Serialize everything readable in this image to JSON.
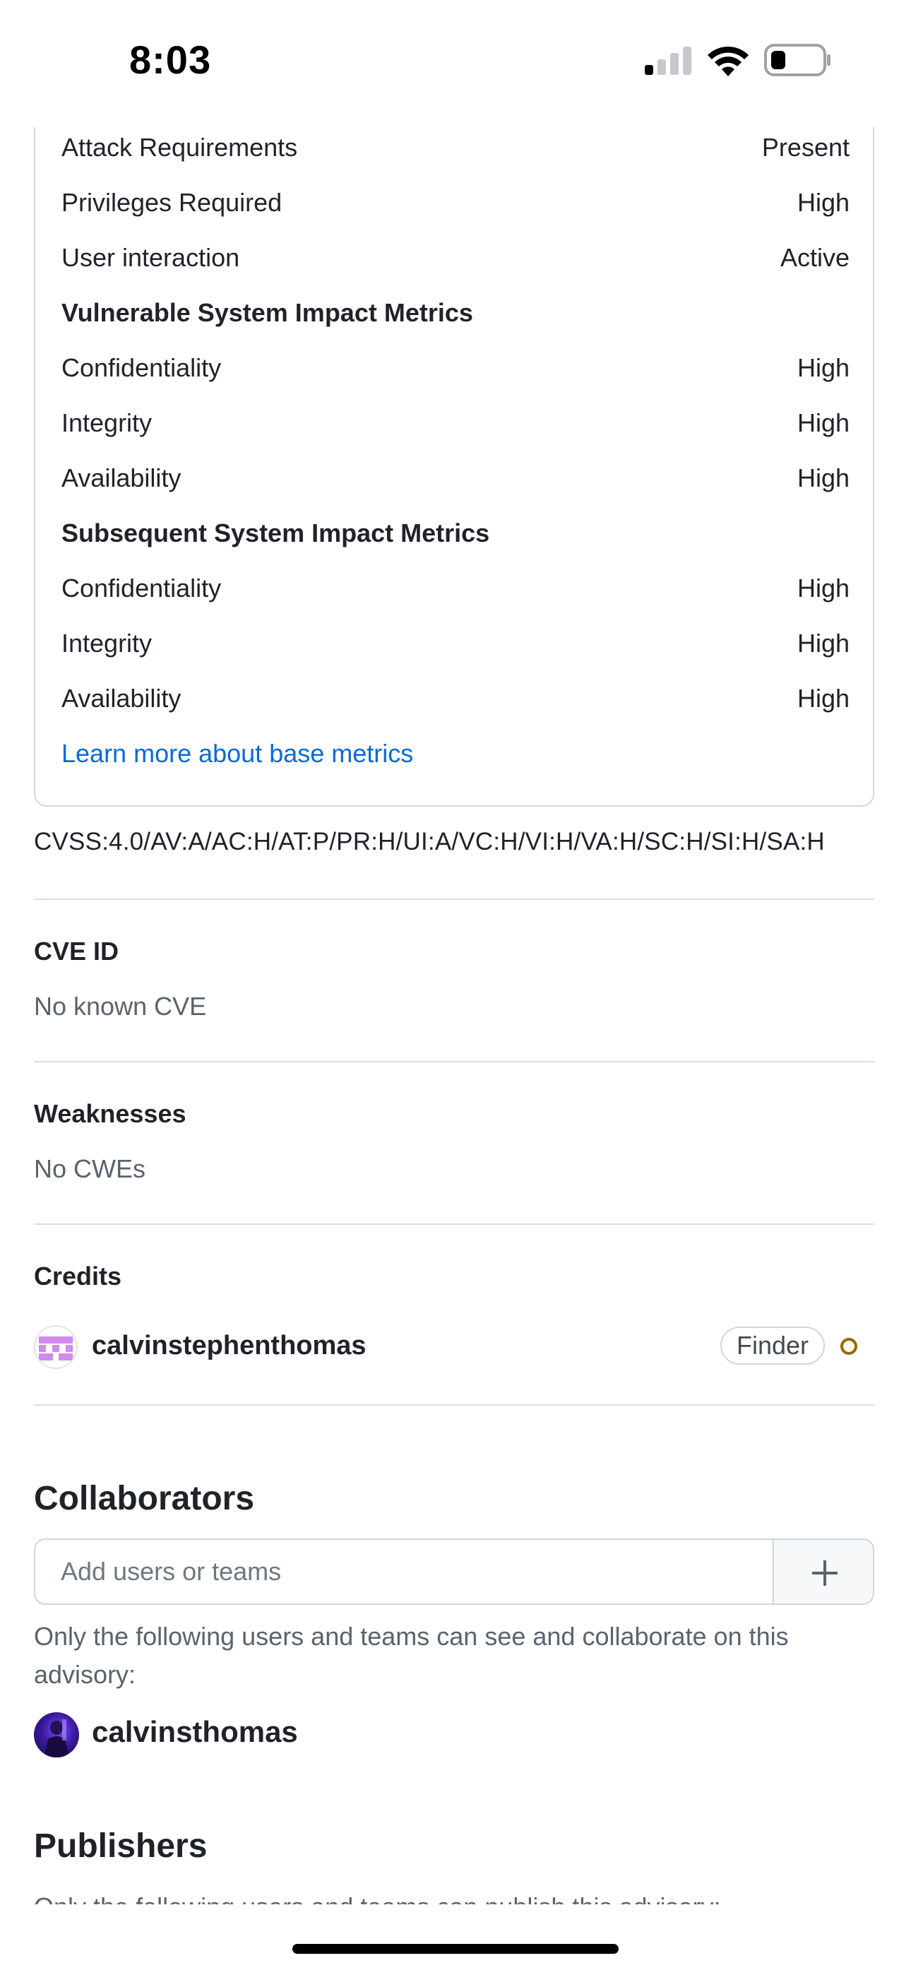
{
  "status_bar": {
    "time": "8:03"
  },
  "base_metrics": {
    "rows_top": [
      {
        "label": "Attack Requirements",
        "value": "Present"
      },
      {
        "label": "Privileges Required",
        "value": "High"
      },
      {
        "label": "User interaction",
        "value": "Active"
      }
    ],
    "vulnerable_heading": "Vulnerable System Impact Metrics",
    "vulnerable_rows": [
      {
        "label": "Confidentiality",
        "value": "High"
      },
      {
        "label": "Integrity",
        "value": "High"
      },
      {
        "label": "Availability",
        "value": "High"
      }
    ],
    "subsequent_heading": "Subsequent System Impact Metrics",
    "subsequent_rows": [
      {
        "label": "Confidentiality",
        "value": "High"
      },
      {
        "label": "Integrity",
        "value": "High"
      },
      {
        "label": "Availability",
        "value": "High"
      }
    ],
    "learn_more": "Learn more about base metrics"
  },
  "cvss_vector": "CVSS:4.0/AV:A/AC:H/AT:P/PR:H/UI:A/VC:H/VI:H/VA:H/SC:H/SI:H/SA:H",
  "cve": {
    "title": "CVE ID",
    "value": "No known CVE"
  },
  "weaknesses": {
    "title": "Weaknesses",
    "value": "No CWEs"
  },
  "credits": {
    "title": "Credits",
    "user": "calvinstephenthomas",
    "role": "Finder",
    "status_color": "#9a6700"
  },
  "collaborators": {
    "title": "Collaborators",
    "input_placeholder": "Add users or teams",
    "description": "Only the following users and teams can see and collaborate on this advisory:",
    "user": "calvinsthomas"
  },
  "publishers": {
    "title": "Publishers",
    "description": "Only the following users and teams can publish this advisory:"
  },
  "colors": {
    "link": "#0969da",
    "muted_text": "#59636e",
    "border": "#d0d7de"
  }
}
